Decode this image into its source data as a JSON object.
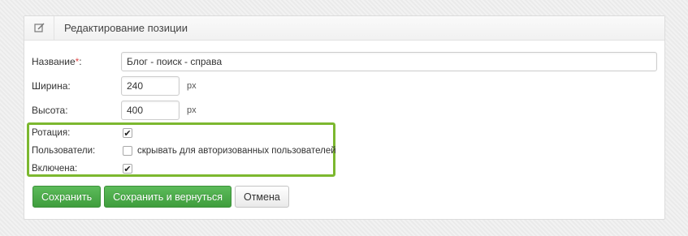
{
  "panel": {
    "title": "Редактирование позиции",
    "icon": "edit-icon"
  },
  "form": {
    "name": {
      "label": "Название",
      "required_mark": "*",
      "suffix": ":",
      "value": "Блог - поиск - справа"
    },
    "width": {
      "label": "Ширина:",
      "value": "240",
      "unit": "px"
    },
    "height": {
      "label": "Высота:",
      "value": "400",
      "unit": "px"
    },
    "rotation": {
      "label": "Ротация:",
      "checked": true,
      "check_glyph": "✔"
    },
    "users": {
      "label": "Пользователи:",
      "checked": false,
      "text": "скрывать для авторизованных пользователей"
    },
    "enabled": {
      "label": "Включена:",
      "checked": true,
      "check_glyph": "✔"
    }
  },
  "buttons": {
    "save": "Сохранить",
    "save_return": "Сохранить и вернуться",
    "cancel": "Отмена"
  },
  "colors": {
    "highlight": "#7cb82f",
    "primary_button": "#4aa948",
    "required": "#e04b4b"
  }
}
